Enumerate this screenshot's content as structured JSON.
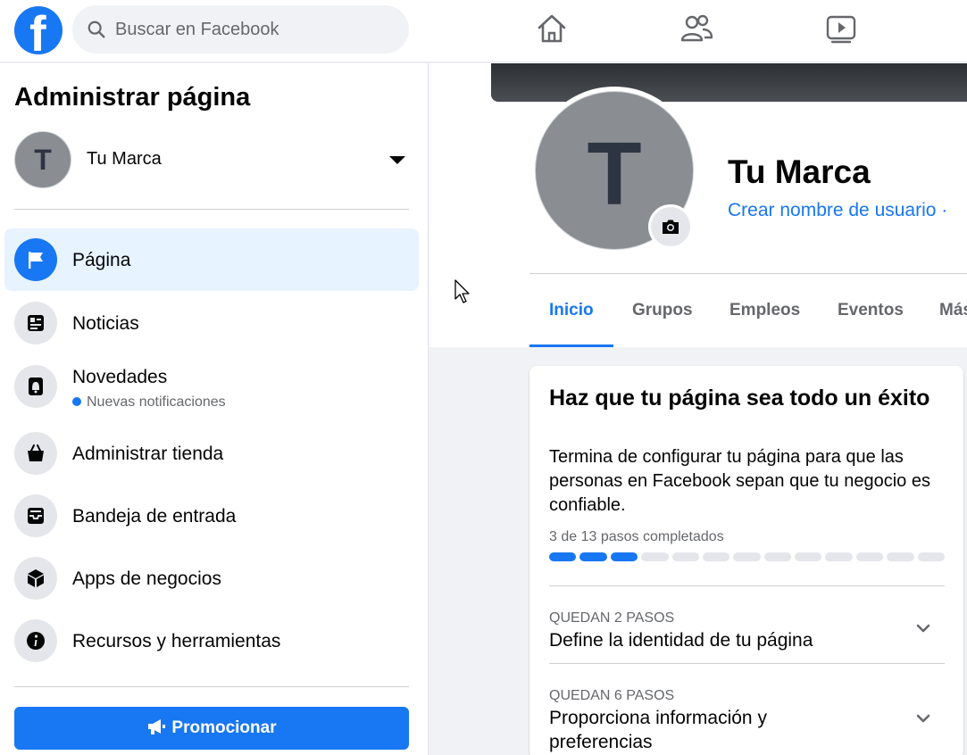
{
  "colors": {
    "brand": "#1877f2",
    "surface": "#ffffff",
    "background": "#f0f2f5"
  },
  "topbar": {
    "logo_glyph": "f",
    "search_placeholder": "Buscar en Facebook",
    "nav_icons": [
      "home-icon",
      "friends-icon",
      "watch-icon"
    ]
  },
  "sidebar": {
    "title": "Administrar página",
    "page": {
      "initial": "T",
      "name": "Tu Marca"
    },
    "items": [
      {
        "label": "Página",
        "icon": "flag-icon",
        "active": true
      },
      {
        "label": "Noticias",
        "icon": "news-icon"
      },
      {
        "label": "Novedades",
        "icon": "bell-icon",
        "sub": "Nuevas notificaciones"
      },
      {
        "label": "Administrar tienda",
        "icon": "shop-bag-icon"
      },
      {
        "label": "Bandeja de entrada",
        "icon": "inbox-icon"
      },
      {
        "label": "Apps de negocios",
        "icon": "cube-icon"
      },
      {
        "label": "Recursos y herramientas",
        "icon": "info-icon"
      }
    ],
    "promote_label": "Promocionar"
  },
  "profile": {
    "initial": "T",
    "name": "Tu Marca",
    "username_link": "Crear nombre de usuario ·"
  },
  "tabs": [
    {
      "label": "Inicio",
      "active": true
    },
    {
      "label": "Grupos"
    },
    {
      "label": "Empleos"
    },
    {
      "label": "Eventos"
    },
    {
      "label": "Más"
    }
  ],
  "setup_card": {
    "title": "Haz que tu página sea todo un éxito",
    "description": "Termina de configurar tu página para que las personas en Facebook sepan que tu negocio es confiable.",
    "progress_text": "3 de 13 pasos completados",
    "steps_completed": 3,
    "steps_total": 13,
    "steps": [
      {
        "remaining": "QUEDAN 2 PASOS",
        "title": "Define la identidad de tu página"
      },
      {
        "remaining": "QUEDAN 6 PASOS",
        "title": "Proporciona información y preferencias"
      }
    ]
  }
}
